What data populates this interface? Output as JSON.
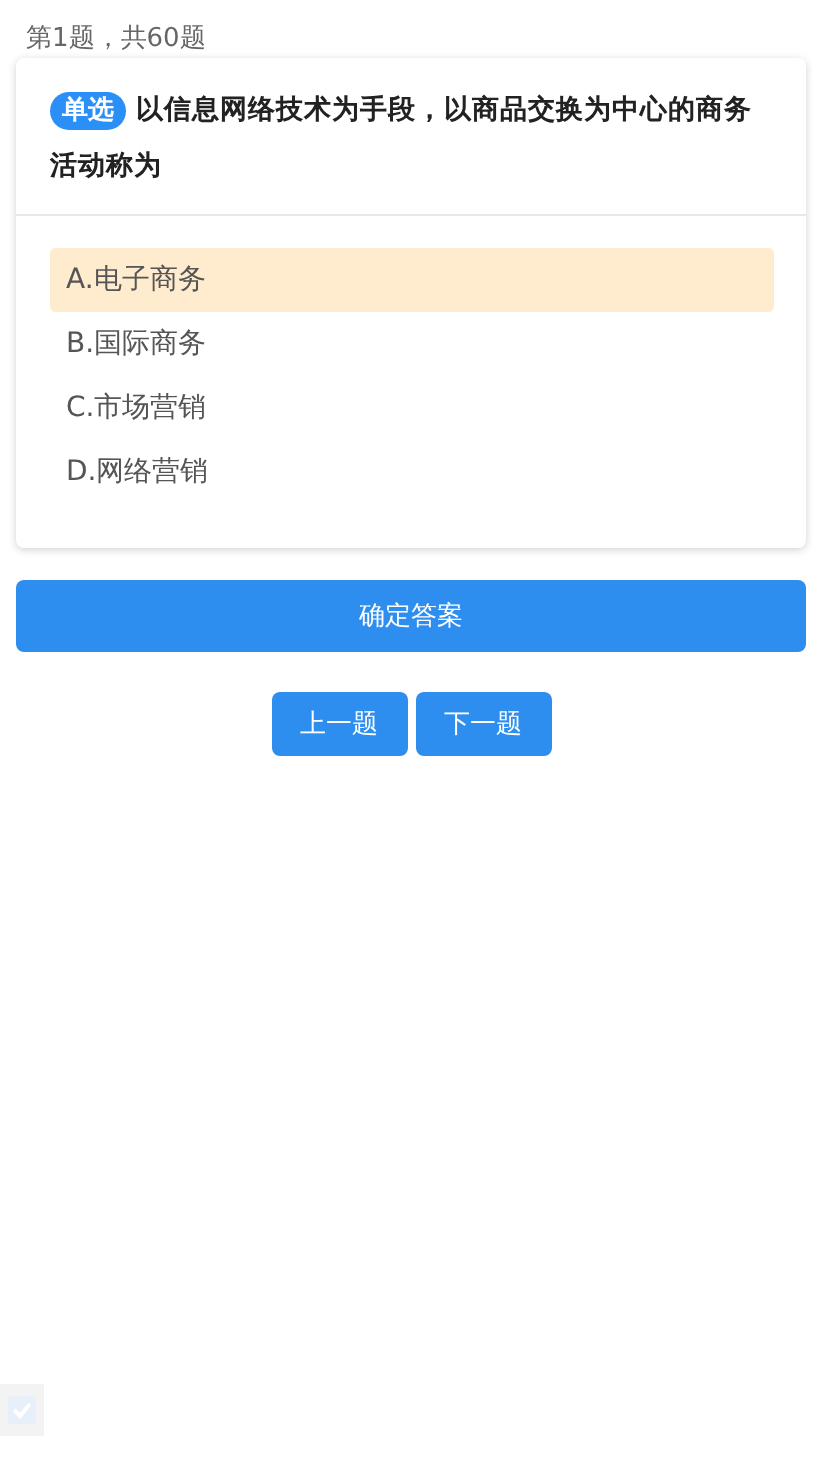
{
  "progress": "第1题，共60题",
  "question": {
    "type_tag": "单选",
    "text": "以信息网络技术为手段，以商品交换为中心的商务活动称为",
    "options": [
      {
        "label": "A.电子商务",
        "selected": true
      },
      {
        "label": "B.国际商务",
        "selected": false
      },
      {
        "label": "C.市场营销",
        "selected": false
      },
      {
        "label": "D.网络营销",
        "selected": false
      }
    ]
  },
  "confirm_button": "确定答案",
  "nav_buttons": [
    "上一题",
    "下一题"
  ]
}
